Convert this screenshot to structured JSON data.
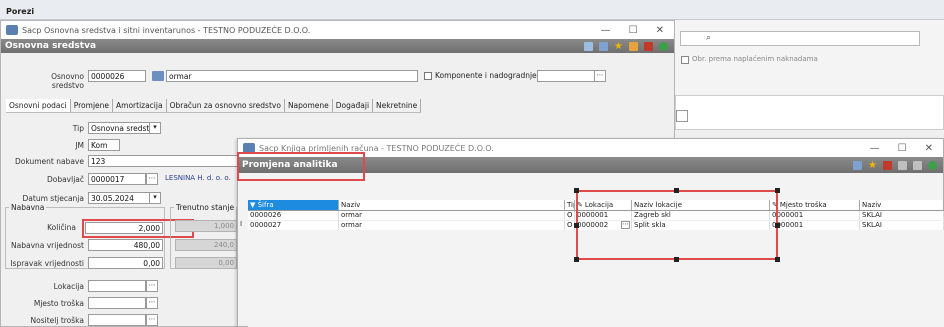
{
  "porezi_label": "Porezi",
  "background": {
    "obr_label": "Obr. prema naplaćenim naknadama"
  },
  "win1": {
    "title": "Sacp Osnovna sredstva i sitni inventarunos - TESTNO PODUZEĆE D.O.O.",
    "panel_title": "Osnovna sredstva",
    "osnovno_label": "Osnovno sredstvo",
    "osnovno_code": "0000026",
    "osnovno_name": "ormar",
    "komponente_label": "Komponente i nadogradnje",
    "tabs": [
      "Osnovni podaci",
      "Promjene",
      "Amortizacija",
      "Obračun za osnovno sredstvo",
      "Napomene",
      "Događaji",
      "Nekretnine"
    ],
    "tip_label": "Tip",
    "tip_value": "Osnovna sredstva",
    "jm_label": "JM",
    "jm_value": "Kom",
    "dokument_label": "Dokument nabave",
    "dokument_value": "123",
    "dobavljac_label": "Dobavljač",
    "dobavljac_code": "0000017",
    "dobavljac_name": "LESNINA H. d. o. o.",
    "datum_label": "Datum stjecanja",
    "datum_value": "30.05.2024",
    "nabavna_group": "Nabavna",
    "kolicina_label": "Količina",
    "kolicina_value": "2,000",
    "trenutno_label": "Trenutno stanje",
    "trenutno_values": [
      "1,000",
      "240,0",
      "0,00"
    ],
    "nabavna_vrijednost_label": "Nabavna vrijednost",
    "nabavna_vrijednost_value": "480,00",
    "ispravak_label": "Ispravak vrijednosti",
    "ispravak_value": "0,00",
    "lokacija_label": "Lokacija",
    "mjesto_label": "Mjesto troška",
    "nositelj_label": "Nositelj troška"
  },
  "win2": {
    "title": "Sacp Knjiga primljenih računa - TESTNO PODUZEĆE D.O.O.",
    "panel_title": "Promjena analitika",
    "columns": [
      "▼ Šifra",
      "Naziv",
      "Tip",
      "Lokacija",
      "Naziv lokacije",
      "Mjesto troška",
      "Naziv"
    ],
    "rows": [
      {
        "sifra": "0000026",
        "naziv": "ormar",
        "tip": "O",
        "lokacija": "0000001",
        "naziv_lokacije": "Zagreb skl",
        "mjesto": "0000001",
        "naziv2": "SKLAI"
      },
      {
        "sifra": "0000027",
        "naziv": "ormar",
        "tip": "O",
        "lokacija": "0000002",
        "naziv_lokacije": "Split skla",
        "mjesto": "0000001",
        "naziv2": "SKLAI"
      }
    ]
  },
  "colors": {
    "highlight_red": "#e04a4a",
    "header_grey": "#7a7a7a",
    "selected_blue": "#1d8ce0"
  }
}
